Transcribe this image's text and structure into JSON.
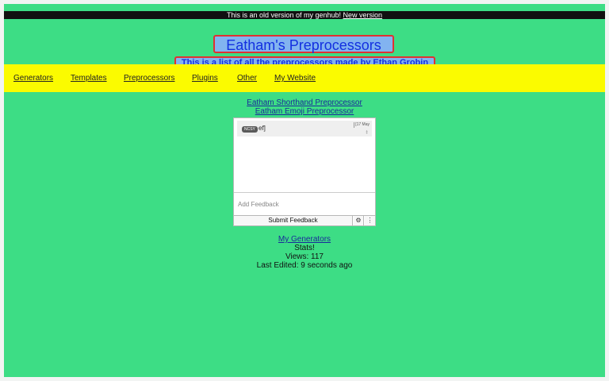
{
  "banner": {
    "text": "This is an old version of my genhub! ",
    "link": "New version"
  },
  "header": {
    "title": "Eatham's Preprocessors",
    "subtitle": "This is a list of all the preprocessors made by Ethan Grobin"
  },
  "nav": {
    "items": [
      "Generators",
      "Templates",
      "Preprocessors",
      "Plugins",
      "Other",
      "My Website"
    ]
  },
  "main": {
    "links": [
      "Eatham Shorthand Preprocessor",
      "Eatham Emoji Preprocessor"
    ]
  },
  "feedback": {
    "message": {
      "tag": "NCSY",
      "text": "ef]",
      "date": "[17 May",
      "date_extra": "‡"
    },
    "input_placeholder": "Add Feedback",
    "submit_label": "Submit Feedback",
    "gear_glyph": "⚙",
    "more_glyph": "⋮"
  },
  "footer": {
    "generators_link": "My Generators",
    "stats_label": "Stats!",
    "views": "Views: 117",
    "last_edited": "Last Edited: 9 seconds ago"
  },
  "colors": {
    "page_bg": "#3ddd85",
    "nav_bg": "#fbfb00",
    "title_text": "#1330e0",
    "title_border": "#e03131"
  }
}
